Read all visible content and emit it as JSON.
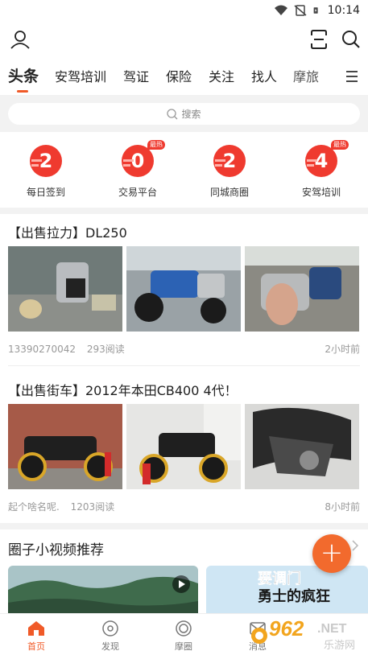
{
  "status_bar": {
    "time": "10:14"
  },
  "tabs": [
    {
      "label": "头条",
      "active": true
    },
    {
      "label": "安驾培训"
    },
    {
      "label": "驾证"
    },
    {
      "label": "保险"
    },
    {
      "label": "关注"
    },
    {
      "label": "找人"
    },
    {
      "label": "摩旅"
    }
  ],
  "search": {
    "placeholder": "搜索"
  },
  "quick_entries": [
    {
      "number": "2",
      "label": "每日签到",
      "hot": ""
    },
    {
      "number": "0",
      "label": "交易平台",
      "hot": "最热"
    },
    {
      "number": "2",
      "label": "同城商圈",
      "hot": ""
    },
    {
      "number": "4",
      "label": "安驾培训",
      "hot": "最热"
    }
  ],
  "posts": [
    {
      "title": "【出售拉力】DL250",
      "author": "13390270042",
      "reads": "293阅读",
      "time": "2小时前"
    },
    {
      "title": "【出售街车】2012年本田CB400 4代！",
      "author": "起个啥名呢.",
      "reads": "1203阅读",
      "time": "8小时前"
    }
  ],
  "video_section": {
    "title": "圈子小视频推荐",
    "video2_caption_line1": "要调门",
    "video2_caption_line2": "勇士的疯狂"
  },
  "bottom_nav": [
    {
      "label": "首页",
      "active": true
    },
    {
      "label": "发现"
    },
    {
      "label": "摩圈"
    },
    {
      "label": "消息"
    }
  ],
  "watermark": {
    "brand": "962",
    "suffix": ".NET",
    "sub": "乐游网"
  },
  "colors": {
    "accent": "#f05a28",
    "badge_red": "#ef3a2f",
    "fab": "#f26a2d"
  }
}
